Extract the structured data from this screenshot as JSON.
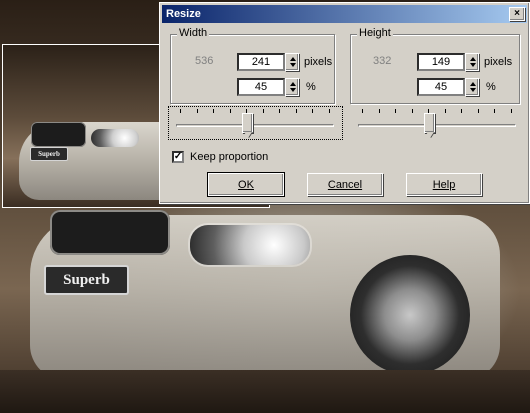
{
  "dialog": {
    "title": "Resize",
    "close_label": "×",
    "width": {
      "label": "Width",
      "original": "536",
      "pixels": "241",
      "pixels_unit": "pixels",
      "percent": "45",
      "percent_unit": "%"
    },
    "height": {
      "label": "Height",
      "original": "332",
      "pixels": "149",
      "pixels_unit": "pixels",
      "percent": "45",
      "percent_unit": "%"
    },
    "sliders": {
      "width_level": 0.45,
      "height_level": 0.45
    },
    "keep_proportion": {
      "label": "Keep proportion",
      "checked": true
    },
    "buttons": {
      "ok": "OK",
      "cancel": "Cancel",
      "help": "Help"
    }
  },
  "photo": {
    "plate_text": "Superb",
    "preview_plate_text": "Superb"
  }
}
